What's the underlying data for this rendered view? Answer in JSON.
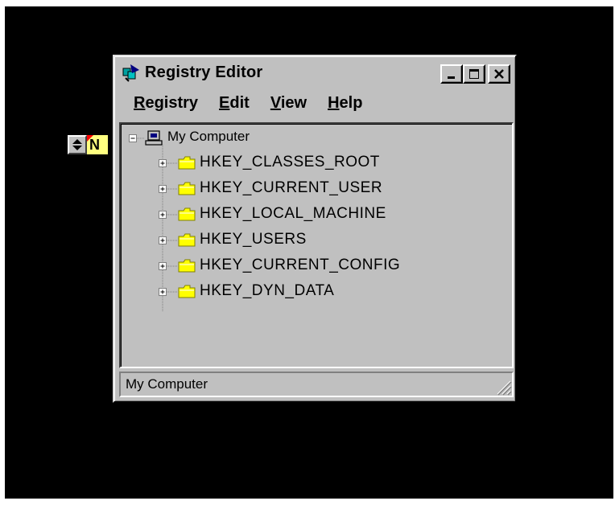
{
  "window": {
    "title": "Registry Editor",
    "buttons": {
      "minimize": "minimize",
      "maximize": "maximize",
      "close": "close"
    }
  },
  "background": {
    "note_letter": "N"
  },
  "menu": [
    {
      "hotkey": "R",
      "rest": "egistry"
    },
    {
      "hotkey": "E",
      "rest": "dit"
    },
    {
      "hotkey": "V",
      "rest": "iew"
    },
    {
      "hotkey": "H",
      "rest": "elp"
    }
  ],
  "tree": {
    "root": {
      "label": "My Computer",
      "icon": "computer-icon",
      "expanded": true
    },
    "hives": [
      {
        "label": "HKEY_CLASSES_ROOT",
        "icon": "folder-icon"
      },
      {
        "label": "HKEY_CURRENT_USER",
        "icon": "folder-icon"
      },
      {
        "label": "HKEY_LOCAL_MACHINE",
        "icon": "folder-icon"
      },
      {
        "label": "HKEY_USERS",
        "icon": "folder-icon"
      },
      {
        "label": "HKEY_CURRENT_CONFIG",
        "icon": "folder-icon"
      },
      {
        "label": "HKEY_DYN_DATA",
        "icon": "folder-icon"
      }
    ]
  },
  "status": {
    "text": "My Computer"
  },
  "colors": {
    "face": "#c0c0c0",
    "folder": "#ffff00",
    "desktop": "#000000",
    "note": "#ffff80"
  }
}
